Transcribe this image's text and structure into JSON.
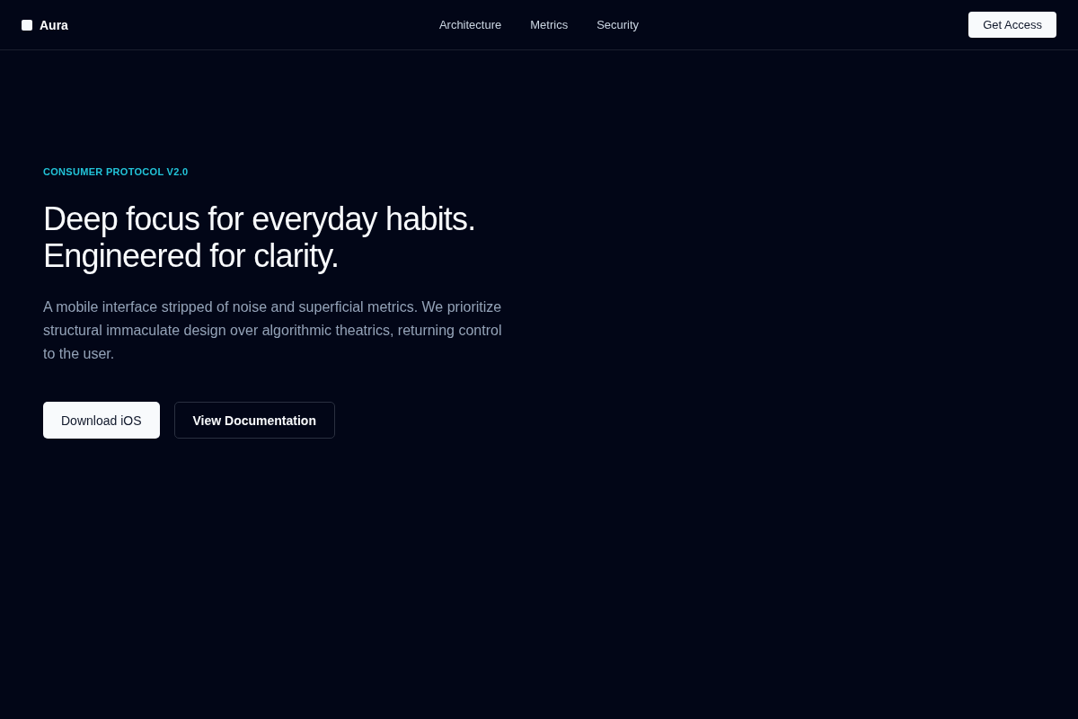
{
  "brand": {
    "name": "Aura"
  },
  "nav": [
    {
      "label": "Architecture"
    },
    {
      "label": "Metrics"
    },
    {
      "label": "Security"
    }
  ],
  "cta": {
    "label": "Get Access"
  },
  "hero": {
    "eyebrow": "CONSUMER PROTOCOL V2.0",
    "headline": [
      "Deep focus for everyday habits.",
      "Engineered for clarity."
    ],
    "body": "A mobile interface stripped of noise and superficial metrics. We prioritize structural immaculate design over algorithmic theatrics, returning control to the user.",
    "buttons": [
      {
        "label": "Download iOS",
        "kind": "primary"
      },
      {
        "label": "View Documentation",
        "kind": "secondary"
      }
    ]
  }
}
